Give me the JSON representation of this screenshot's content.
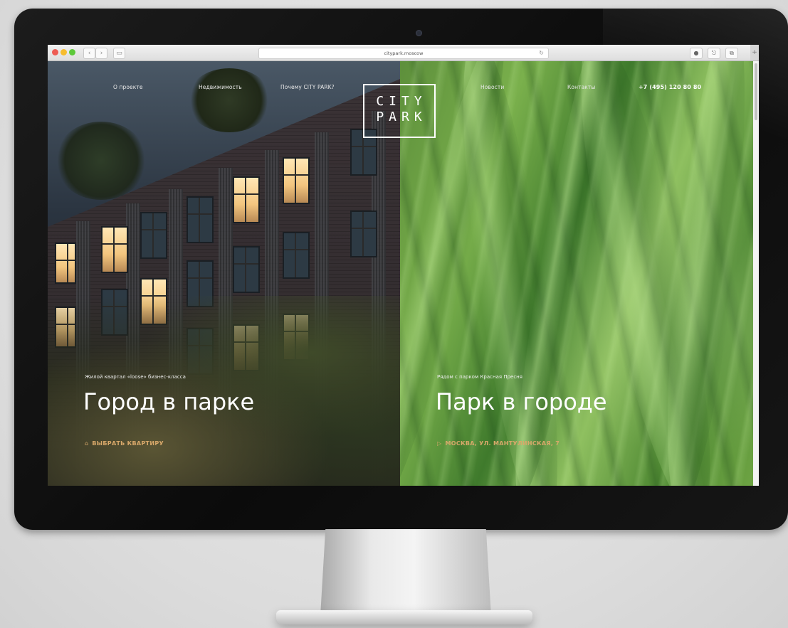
{
  "browser": {
    "url": "citypark.moscow",
    "back": "‹",
    "forward": "›",
    "sidebar_btn": "▭",
    "reload": "↻",
    "share": "⎋",
    "tabs_btn": "⧉",
    "add_tab": "+"
  },
  "nav": {
    "about": "О проекте",
    "realty": "Недвижимость",
    "why": "Почему CITY PARK?",
    "news": "Новости",
    "contacts": "Контакты",
    "phone": "+7 (495) 120 80 80"
  },
  "logo": {
    "line1": "CITY",
    "line2": "PARK"
  },
  "left": {
    "subtitle": "Жилой квартал «loose» бизнес-класса",
    "headline": "Город в парке",
    "cta": "ВЫБРАТЬ КВАРТИРУ",
    "cta_icon": "⌂"
  },
  "right": {
    "subtitle": "Рядом с парком Красная Пресня",
    "headline": "Парк в городе",
    "cta": "МОСКВА, УЛ. МАНТУЛИНСКАЯ, 7",
    "cta_icon": "▷"
  },
  "colors": {
    "accent": "#d8a86a",
    "grass": "#6fa544",
    "frame": "#0b0b0b"
  }
}
